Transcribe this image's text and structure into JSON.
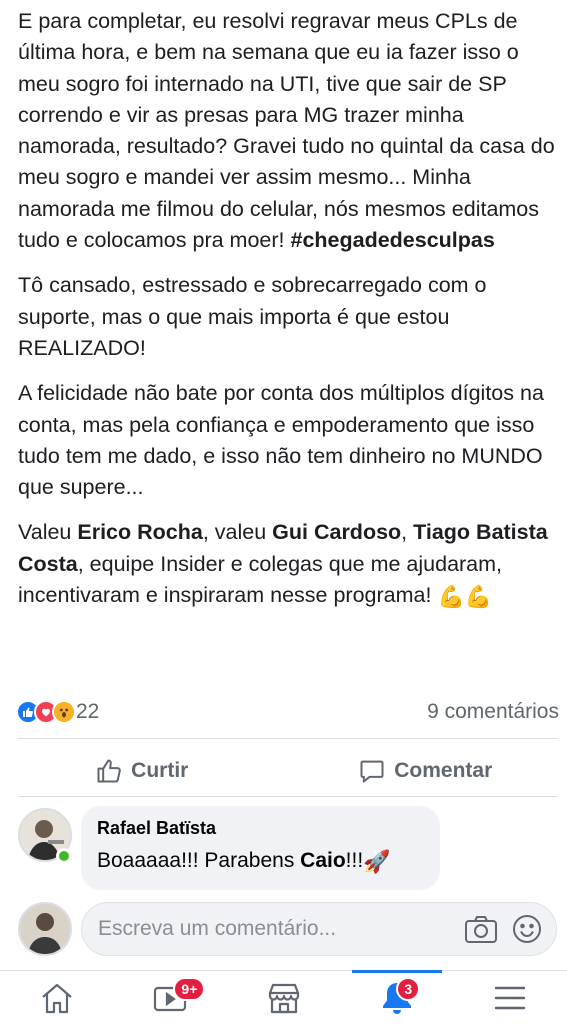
{
  "post": {
    "p1_text": "E para completar, eu resolvi regravar meus CPLs de última hora, e bem na semana que eu ia fazer isso o meu sogro foi internado na UTI, tive que sair de SP correndo e vir as presas para MG trazer minha namorada, resultado? Gravei tudo no quintal da casa do meu sogro e mandei ver assim mesmo... Minha namorada me filmou do celular, nós mesmos editamos tudo e colocamos pra moer!",
    "p1_hashtag": "#chegadedesculpas",
    "p2": "Tô cansado, estressado e sobrecarregado com o suporte, mas o que mais importa é que estou REALIZADO!",
    "p3": "A felicidade não bate por conta dos múltiplos dígitos na conta, mas pela confiança e empoderamento que isso tudo tem me dado, e isso não tem dinheiro no MUNDO que supere...",
    "p4": {
      "t1": "Valeu ",
      "n1": "Erico Rocha",
      "t2": ", valeu ",
      "n2": "Gui Cardoso",
      "t3": ", ",
      "n3": "Tiago Batista Costa",
      "t4": ", equipe Insider e colegas que me ajudaram, incentivaram e inspiraram nesse programa! ",
      "emoji": "💪💪"
    }
  },
  "reactions": {
    "count": "22",
    "comments": "9 comentários",
    "icons": [
      "like-icon",
      "love-icon",
      "wow-icon"
    ]
  },
  "actions": {
    "like_label": "Curtir",
    "comment_label": "Comentar"
  },
  "comment": {
    "author": "Rafael Batïsta",
    "text_before": "Boaaaaa!!! Parabens ",
    "text_bold": "Caio",
    "text_after": "!!!",
    "emoji": "🚀"
  },
  "compose": {
    "placeholder": "Escreva um comentário..."
  },
  "tabbar": {
    "video_badge": "9+",
    "notifications_badge": "3"
  },
  "colors": {
    "accent": "#1877f2",
    "badge": "#e41e3f",
    "online": "#42b72a"
  }
}
